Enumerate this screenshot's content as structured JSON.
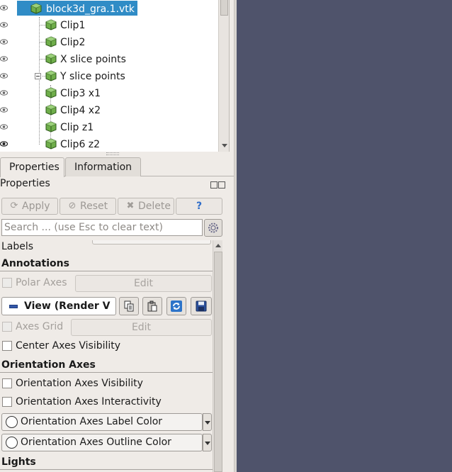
{
  "pipeline": {
    "items": [
      {
        "label": "block3d_gra.1.vtk",
        "selected": true
      },
      {
        "label": "Clip1"
      },
      {
        "label": "Clip2"
      },
      {
        "label": "X slice points"
      },
      {
        "label": "Y slice points"
      },
      {
        "label": "Clip3 x1"
      },
      {
        "label": "Clip4 x2"
      },
      {
        "label": "Clip z1"
      },
      {
        "label": "Clip6 z2"
      }
    ]
  },
  "tabs": [
    {
      "label": "Properties",
      "active": true
    },
    {
      "label": "Information",
      "active": false
    }
  ],
  "panel": {
    "title": "Properties"
  },
  "actions": {
    "apply": "Apply",
    "reset": "Reset",
    "delete": "Delete",
    "help": "?"
  },
  "search": {
    "placeholder": "Search ... (use Esc to clear text)"
  },
  "props": {
    "labels_row": "Labels",
    "annotations": {
      "title": "Annotations",
      "polar_axes": "Polar Axes",
      "polar_edit": "Edit",
      "view_combo": "View (Render V",
      "axes_grid": "Axes Grid",
      "axes_grid_edit": "Edit",
      "center_axes": "Center Axes Visibility"
    },
    "orientation": {
      "title": "Orientation Axes",
      "visibility": "Orientation Axes Visibility",
      "interactivity": "Orientation Axes Interactivity",
      "label_color": "Orientation Axes Label Color",
      "outline_color": "Orientation Axes Outline Color"
    },
    "lights": {
      "title": "Lights"
    }
  },
  "colors": {
    "selection": "#308cc6",
    "render_view_bg": "#4f536b",
    "cube_green": "#6fae4a"
  }
}
